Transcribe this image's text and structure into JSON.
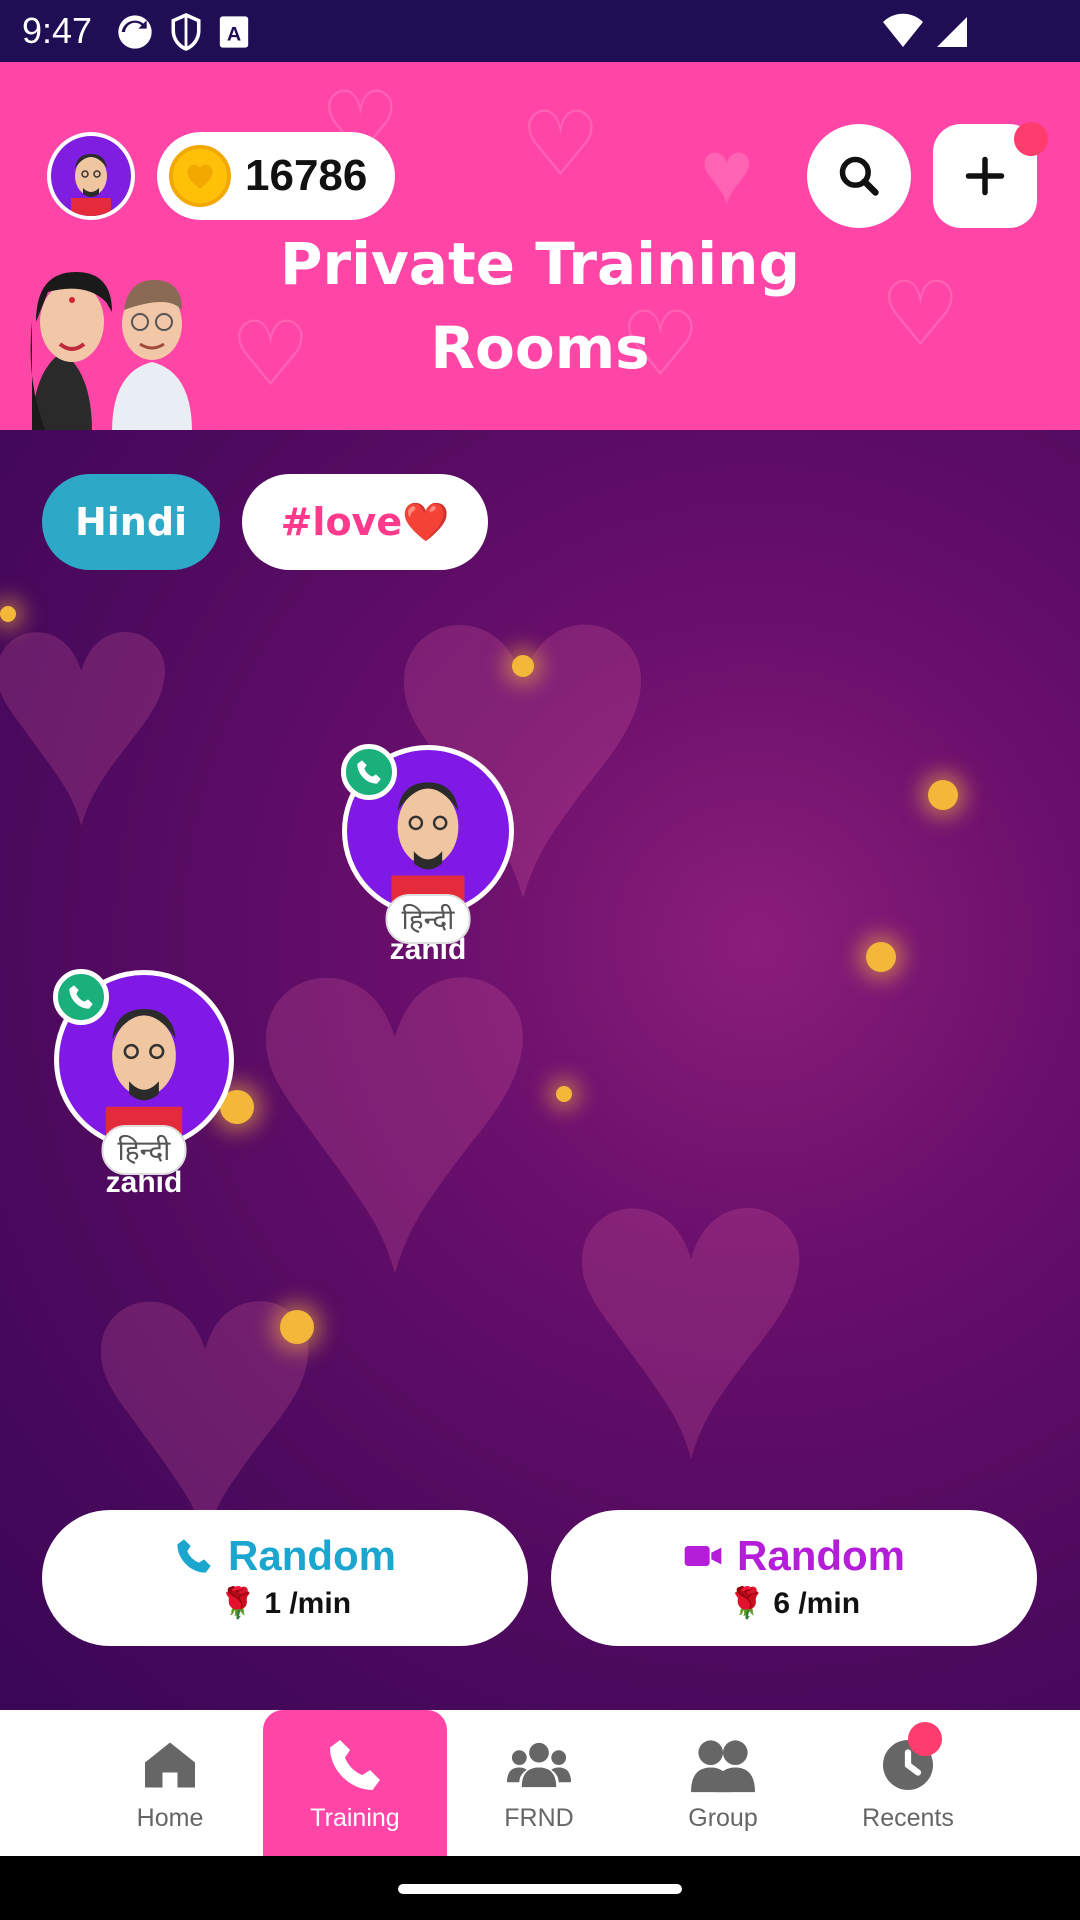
{
  "status_bar": {
    "time": "9:47"
  },
  "header": {
    "coin_count": "16786",
    "title_line1": "Private Training",
    "title_line2": "Rooms"
  },
  "chips": [
    {
      "label": "Hindi"
    },
    {
      "label": "#love❤️"
    }
  ],
  "users": [
    {
      "name": "zahid",
      "language": "हिन्दी"
    },
    {
      "name": "zahid",
      "language": "हिन्दी"
    }
  ],
  "random_buttons": [
    {
      "label": "Random",
      "price": "1 /min"
    },
    {
      "label": "Random",
      "price": "6 /min"
    }
  ],
  "nav": [
    {
      "label": "Home"
    },
    {
      "label": "Training"
    },
    {
      "label": "FRND"
    },
    {
      "label": "Group"
    },
    {
      "label": "Recents"
    }
  ],
  "colors": {
    "header_bg": "#ff46a6",
    "hindi_chip": "#2ea8c7",
    "voice_accent": "#1aa6cf",
    "video_accent": "#b51ed8",
    "avatar_bg": "#8019e6"
  }
}
